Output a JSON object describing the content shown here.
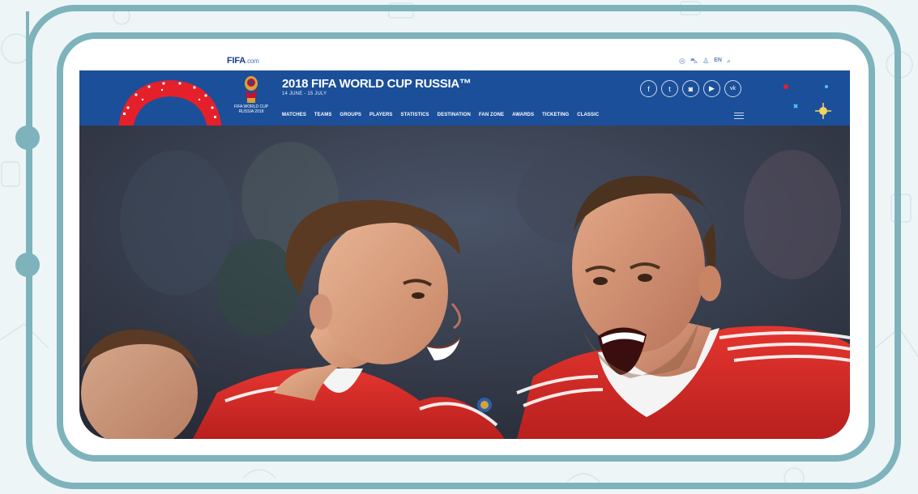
{
  "site": {
    "logo_text": "FIFA",
    "logo_suffix": ".com"
  },
  "header": {
    "title": "2018 FIFA WORLD CUP RUSSIA™",
    "dates": "14 JUNE - 15 JULY",
    "emblem_text": "FIFA WORLD CUP RUSSIA 2018",
    "language": "EN"
  },
  "nav": {
    "items": [
      "MATCHES",
      "TEAMS",
      "GROUPS",
      "PLAYERS",
      "STATISTICS",
      "DESTINATION",
      "FAN ZONE",
      "AWARDS",
      "TICKETING",
      "CLASSIC"
    ]
  },
  "utility_icons": [
    "globe-icon",
    "cart-icon",
    "user-icon",
    "language-label",
    "search-icon"
  ],
  "social_icons": [
    "facebook-icon",
    "twitter-icon",
    "instagram-icon",
    "youtube-icon",
    "vk-icon"
  ],
  "colors": {
    "header_bg": "#1b4f9a",
    "frame": "#7eb3bc",
    "jersey_red": "#d8282a"
  }
}
